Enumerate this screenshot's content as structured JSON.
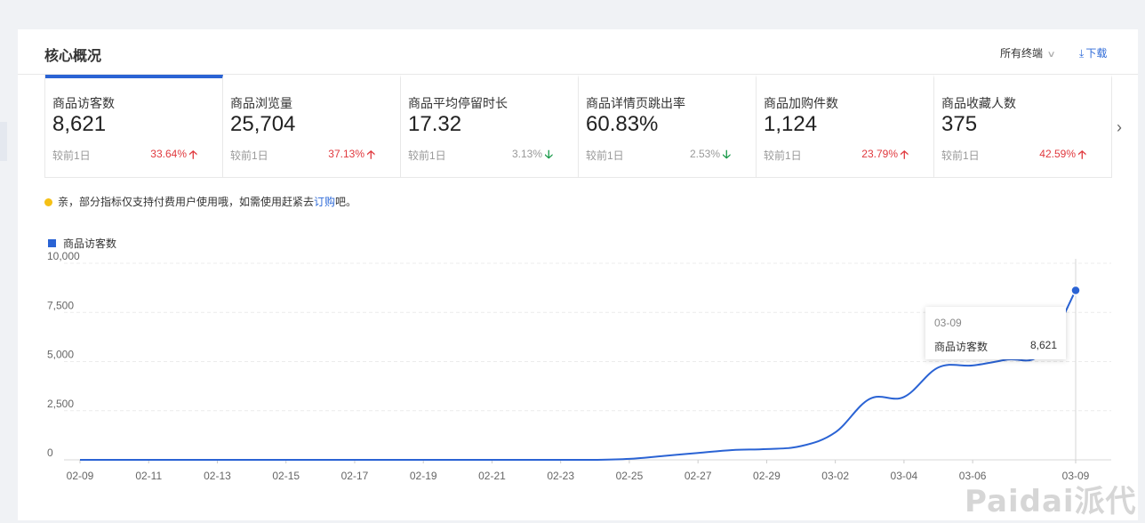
{
  "header": {
    "title": "核心概况",
    "terminal_select": "所有终端",
    "download_label": "下载"
  },
  "metrics": [
    {
      "label": "商品访客数",
      "value": "8,621",
      "compare": "较前1日",
      "change": "33.64%",
      "direction": "up",
      "active": true
    },
    {
      "label": "商品浏览量",
      "value": "25,704",
      "compare": "较前1日",
      "change": "37.13%",
      "direction": "up"
    },
    {
      "label": "商品平均停留时长",
      "value": "17.32",
      "compare": "较前1日",
      "change": "3.13%",
      "direction": "down"
    },
    {
      "label": "商品详情页跳出率",
      "value": "60.83%",
      "compare": "较前1日",
      "change": "2.53%",
      "direction": "down"
    },
    {
      "label": "商品加购件数",
      "value": "1,124",
      "compare": "较前1日",
      "change": "23.79%",
      "direction": "up"
    },
    {
      "label": "商品收藏人数",
      "value": "375",
      "compare": "较前1日",
      "change": "42.59%",
      "direction": "up"
    }
  ],
  "notice": {
    "prefix": "亲，部分指标仅支持付费用户使用哦，如需使用赶紧去",
    "link": "订购",
    "suffix": "吧。"
  },
  "watermark": "Paidai派代",
  "tooltip": {
    "date": "03-09",
    "series": "商品访客数",
    "value": "8,621"
  },
  "colors": {
    "accent": "#2a63d4",
    "up": "#e0393e",
    "down": "#1a9a4a",
    "warning": "#f5c016"
  },
  "chart_data": {
    "type": "line",
    "legend": "top-left",
    "grid": true,
    "ylim": [
      0,
      10000
    ],
    "y_ticks": [
      "0",
      "2,500",
      "5,000",
      "7,500",
      "10,000"
    ],
    "x_tick_labels": [
      "02-09",
      "02-11",
      "02-13",
      "02-15",
      "02-17",
      "02-19",
      "02-21",
      "02-23",
      "02-25",
      "02-27",
      "02-29",
      "03-02",
      "03-04",
      "03-06",
      "03-09"
    ],
    "x": [
      "02-09",
      "02-10",
      "02-11",
      "02-12",
      "02-13",
      "02-14",
      "02-15",
      "02-16",
      "02-17",
      "02-18",
      "02-19",
      "02-20",
      "02-21",
      "02-22",
      "02-23",
      "02-24",
      "02-25",
      "02-26",
      "02-27",
      "02-28",
      "02-29",
      "03-01",
      "03-02",
      "03-03",
      "03-04",
      "03-05",
      "03-06",
      "03-07",
      "03-08",
      "03-09"
    ],
    "series": [
      {
        "name": "商品访客数",
        "values": [
          0,
          0,
          0,
          0,
          0,
          0,
          0,
          0,
          0,
          0,
          0,
          0,
          0,
          0,
          0,
          0,
          50,
          200,
          350,
          500,
          550,
          700,
          1400,
          3100,
          3200,
          4700,
          4800,
          5100,
          5400,
          8621
        ]
      }
    ]
  }
}
